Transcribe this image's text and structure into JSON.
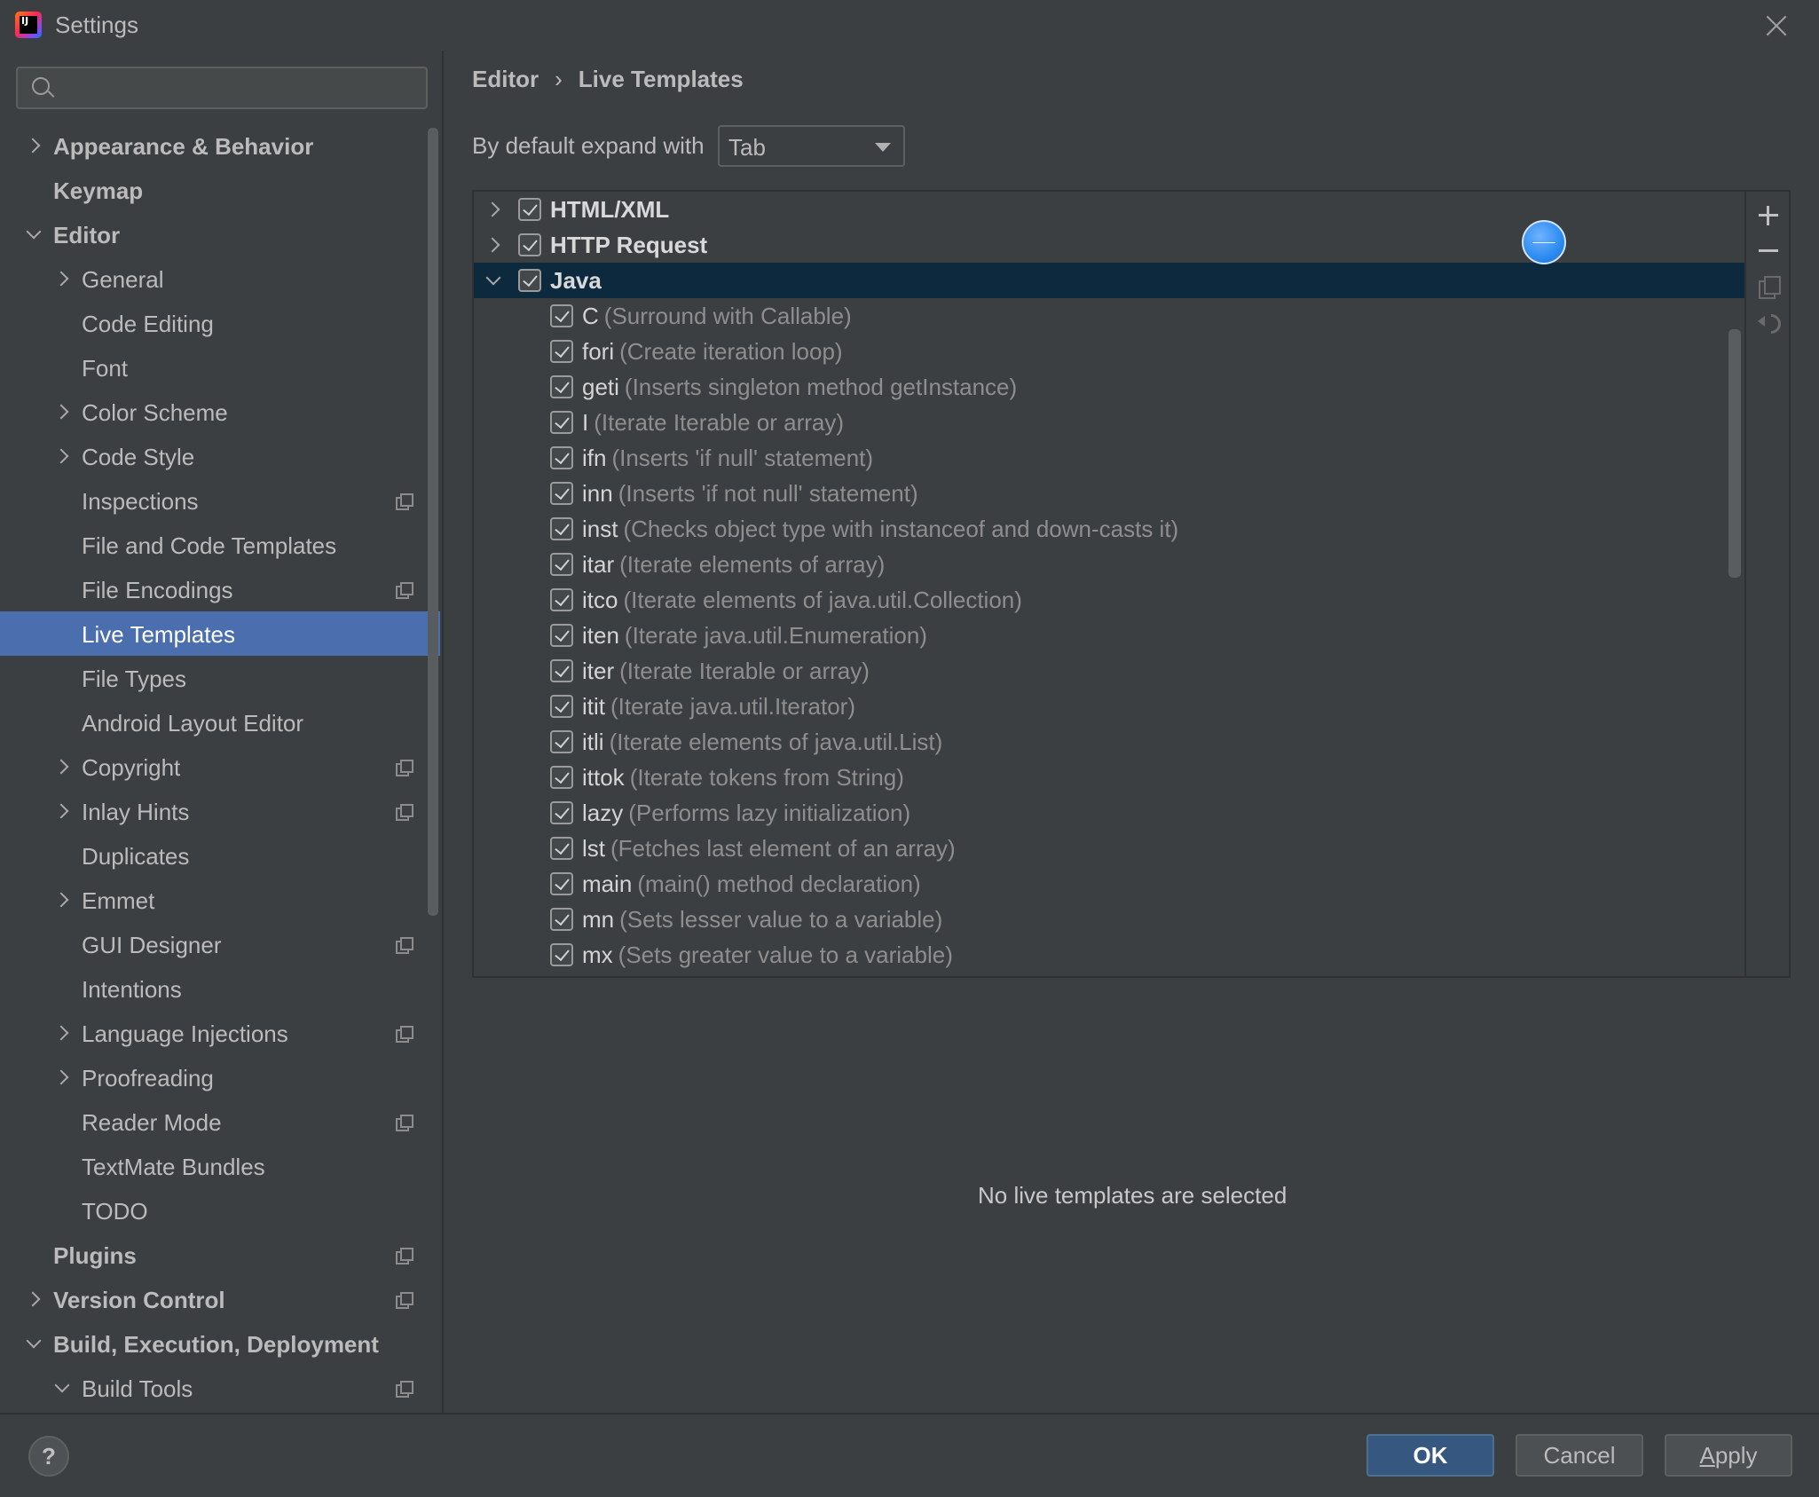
{
  "window": {
    "title": "Settings",
    "app_icon_text": "IJ"
  },
  "search": {
    "placeholder": "",
    "value": ""
  },
  "sidebar": {
    "items": [
      {
        "label": "Appearance & Behavior",
        "level": 0,
        "expander": "right",
        "bold": true,
        "project_icon": false
      },
      {
        "label": "Keymap",
        "level": 0,
        "expander": "none",
        "bold": true,
        "project_icon": false
      },
      {
        "label": "Editor",
        "level": 0,
        "expander": "down",
        "bold": true,
        "project_icon": false
      },
      {
        "label": "General",
        "level": 1,
        "expander": "right",
        "bold": false,
        "project_icon": false
      },
      {
        "label": "Code Editing",
        "level": 1,
        "expander": "none",
        "bold": false,
        "project_icon": false
      },
      {
        "label": "Font",
        "level": 1,
        "expander": "none",
        "bold": false,
        "project_icon": false
      },
      {
        "label": "Color Scheme",
        "level": 1,
        "expander": "right",
        "bold": false,
        "project_icon": false
      },
      {
        "label": "Code Style",
        "level": 1,
        "expander": "right",
        "bold": false,
        "project_icon": false
      },
      {
        "label": "Inspections",
        "level": 1,
        "expander": "none",
        "bold": false,
        "project_icon": true
      },
      {
        "label": "File and Code Templates",
        "level": 1,
        "expander": "none",
        "bold": false,
        "project_icon": false
      },
      {
        "label": "File Encodings",
        "level": 1,
        "expander": "none",
        "bold": false,
        "project_icon": true
      },
      {
        "label": "Live Templates",
        "level": 1,
        "expander": "none",
        "bold": false,
        "project_icon": false,
        "selected": true
      },
      {
        "label": "File Types",
        "level": 1,
        "expander": "none",
        "bold": false,
        "project_icon": false
      },
      {
        "label": "Android Layout Editor",
        "level": 1,
        "expander": "none",
        "bold": false,
        "project_icon": false
      },
      {
        "label": "Copyright",
        "level": 1,
        "expander": "right",
        "bold": false,
        "project_icon": true
      },
      {
        "label": "Inlay Hints",
        "level": 1,
        "expander": "right",
        "bold": false,
        "project_icon": true
      },
      {
        "label": "Duplicates",
        "level": 1,
        "expander": "none",
        "bold": false,
        "project_icon": false
      },
      {
        "label": "Emmet",
        "level": 1,
        "expander": "right",
        "bold": false,
        "project_icon": false
      },
      {
        "label": "GUI Designer",
        "level": 1,
        "expander": "none",
        "bold": false,
        "project_icon": true
      },
      {
        "label": "Intentions",
        "level": 1,
        "expander": "none",
        "bold": false,
        "project_icon": false
      },
      {
        "label": "Language Injections",
        "level": 1,
        "expander": "right",
        "bold": false,
        "project_icon": true
      },
      {
        "label": "Proofreading",
        "level": 1,
        "expander": "right",
        "bold": false,
        "project_icon": false
      },
      {
        "label": "Reader Mode",
        "level": 1,
        "expander": "none",
        "bold": false,
        "project_icon": true
      },
      {
        "label": "TextMate Bundles",
        "level": 1,
        "expander": "none",
        "bold": false,
        "project_icon": false
      },
      {
        "label": "TODO",
        "level": 1,
        "expander": "none",
        "bold": false,
        "project_icon": false
      },
      {
        "label": "Plugins",
        "level": 0,
        "expander": "none",
        "bold": true,
        "project_icon": true
      },
      {
        "label": "Version Control",
        "level": 0,
        "expander": "right",
        "bold": true,
        "project_icon": true
      },
      {
        "label": "Build, Execution, Deployment",
        "level": 0,
        "expander": "down",
        "bold": true,
        "project_icon": false
      },
      {
        "label": "Build Tools",
        "level": 1,
        "expander": "down",
        "bold": false,
        "project_icon": true
      }
    ]
  },
  "breadcrumb": {
    "parent": "Editor",
    "separator": "›",
    "current": "Live Templates"
  },
  "expand_with": {
    "label": "By default expand with",
    "value": "Tab"
  },
  "templates": {
    "groups": [
      {
        "name": "HTML/XML",
        "expanded": false,
        "checked": true,
        "selected": false
      },
      {
        "name": "HTTP Request",
        "expanded": false,
        "checked": true,
        "selected": false
      },
      {
        "name": "Java",
        "expanded": true,
        "checked": true,
        "selected": true
      }
    ],
    "items": [
      {
        "abbr": "C",
        "desc": "(Surround with Callable)",
        "checked": true
      },
      {
        "abbr": "fori",
        "desc": "(Create iteration loop)",
        "checked": true
      },
      {
        "abbr": "geti",
        "desc": "(Inserts singleton method getInstance)",
        "checked": true
      },
      {
        "abbr": "I",
        "desc": "(Iterate Iterable or array)",
        "checked": true
      },
      {
        "abbr": "ifn",
        "desc": "(Inserts 'if null' statement)",
        "checked": true
      },
      {
        "abbr": "inn",
        "desc": "(Inserts 'if not null' statement)",
        "checked": true
      },
      {
        "abbr": "inst",
        "desc": "(Checks object type with instanceof and down-casts it)",
        "checked": true
      },
      {
        "abbr": "itar",
        "desc": "(Iterate elements of array)",
        "checked": true
      },
      {
        "abbr": "itco",
        "desc": "(Iterate elements of java.util.Collection)",
        "checked": true
      },
      {
        "abbr": "iten",
        "desc": "(Iterate java.util.Enumeration)",
        "checked": true
      },
      {
        "abbr": "iter",
        "desc": "(Iterate Iterable or array)",
        "checked": true
      },
      {
        "abbr": "itit",
        "desc": "(Iterate java.util.Iterator)",
        "checked": true
      },
      {
        "abbr": "itli",
        "desc": "(Iterate elements of java.util.List)",
        "checked": true
      },
      {
        "abbr": "ittok",
        "desc": "(Iterate tokens from String)",
        "checked": true
      },
      {
        "abbr": "lazy",
        "desc": "(Performs lazy initialization)",
        "checked": true
      },
      {
        "abbr": "lst",
        "desc": "(Fetches last element of an array)",
        "checked": true
      },
      {
        "abbr": "main",
        "desc": "(main() method declaration)",
        "checked": true
      },
      {
        "abbr": "mn",
        "desc": "(Sets lesser value to a variable)",
        "checked": true
      },
      {
        "abbr": "mx",
        "desc": "(Sets greater value to a variable)",
        "checked": true
      }
    ]
  },
  "toolbar": {
    "icons": [
      "plus-icon",
      "minus-icon",
      "copy-icon",
      "revert-icon"
    ]
  },
  "empty_message": "No live templates are selected",
  "buttons": {
    "help": "?",
    "ok": "OK",
    "cancel": "Cancel",
    "apply_prefix": "",
    "apply_mnemonic": "A",
    "apply_rest": "pply"
  },
  "colors": {
    "background": "#3c3f41",
    "selection": "#4b6eaf",
    "tree_selection": "#0d293e",
    "primary_button": "#365880"
  }
}
